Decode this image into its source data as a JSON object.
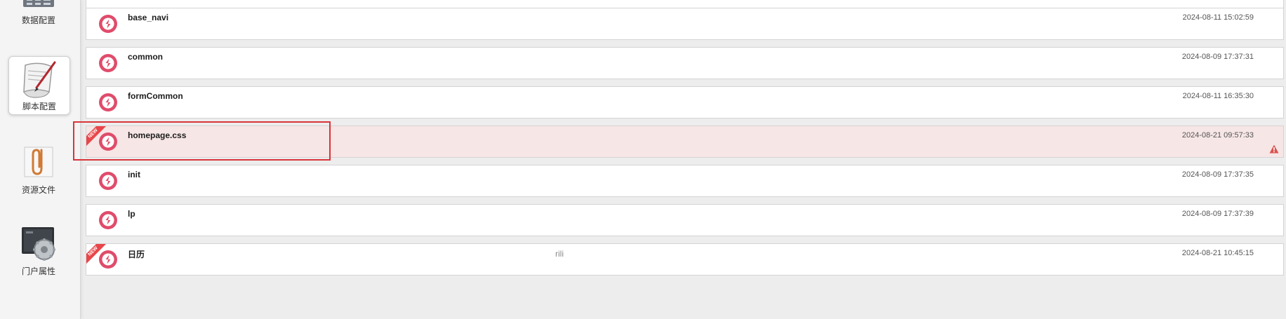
{
  "sidebar": {
    "items": [
      {
        "label": "数据配置",
        "icon": "database-config-icon",
        "active": false
      },
      {
        "label": "脚本配置",
        "icon": "script-scroll-icon",
        "active": true
      },
      {
        "label": "资源文件",
        "icon": "paperclip-icon",
        "active": false
      },
      {
        "label": "门户属性",
        "icon": "settings-gear-icon",
        "active": false
      }
    ]
  },
  "scripts": [
    {
      "name": "base_navi",
      "desc": "",
      "time": "2024-08-11 15:02:59",
      "is_new": false,
      "has_error": false
    },
    {
      "name": "common",
      "desc": "",
      "time": "2024-08-09 17:37:31",
      "is_new": false,
      "has_error": false
    },
    {
      "name": "formCommon",
      "desc": "",
      "time": "2024-08-11 16:35:30",
      "is_new": false,
      "has_error": false
    },
    {
      "name": "homepage.css",
      "desc": "",
      "time": "2024-08-21 09:57:33",
      "is_new": true,
      "has_error": true
    },
    {
      "name": "init",
      "desc": "",
      "time": "2024-08-09 17:37:35",
      "is_new": false,
      "has_error": false
    },
    {
      "name": "lp",
      "desc": "",
      "time": "2024-08-09 17:37:39",
      "is_new": false,
      "has_error": false
    },
    {
      "name": "日历",
      "desc": "rili",
      "time": "2024-08-21 10:45:15",
      "is_new": true,
      "has_error": false
    }
  ],
  "labels": {
    "new_ribbon": "NEW"
  },
  "colors": {
    "badge": "#e04c6b",
    "error_row_bg": "#f6e6e5",
    "highlight": "#d9343a",
    "warning": "#d9534f"
  }
}
